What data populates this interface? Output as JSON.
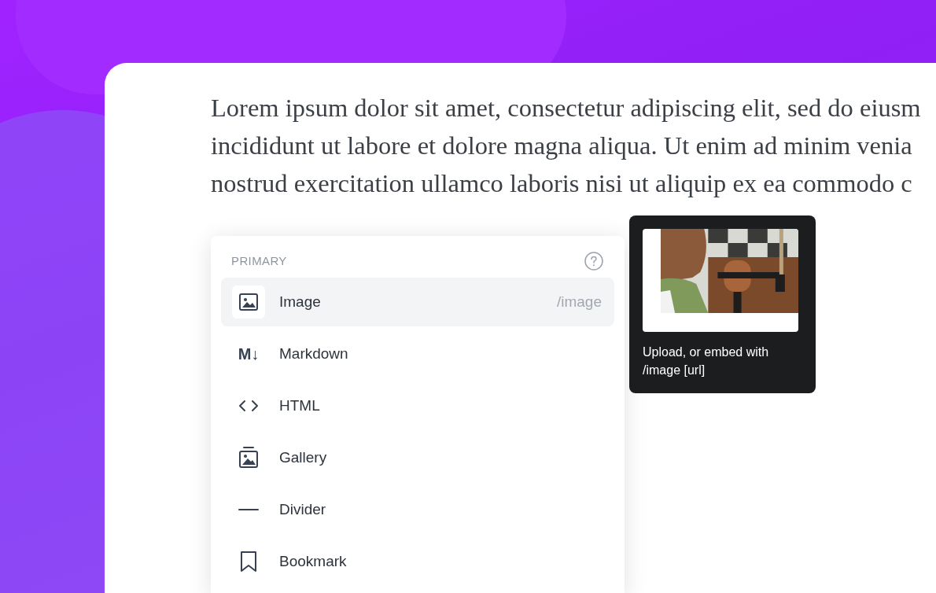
{
  "paragraph": {
    "lines": [
      "Lorem ipsum dolor sit amet, consectetur adipiscing elit, sed do eiusm",
      "incididunt ut labore et dolore magna aliqua. Ut enim ad minim venia",
      "nostrud exercitation ullamco laboris nisi ut aliquip ex ea commodo c"
    ]
  },
  "menu": {
    "section": "PRIMARY",
    "items": [
      {
        "label": "Image",
        "shortcut": "/image",
        "selected": true
      },
      {
        "label": "Markdown",
        "icon_text": "M↓",
        "selected": false
      },
      {
        "label": "HTML",
        "selected": false
      },
      {
        "label": "Gallery",
        "selected": false
      },
      {
        "label": "Divider",
        "selected": false
      },
      {
        "label": "Bookmark",
        "selected": false
      }
    ]
  },
  "tooltip": {
    "caption": "Upload, or embed with /image [url]"
  }
}
